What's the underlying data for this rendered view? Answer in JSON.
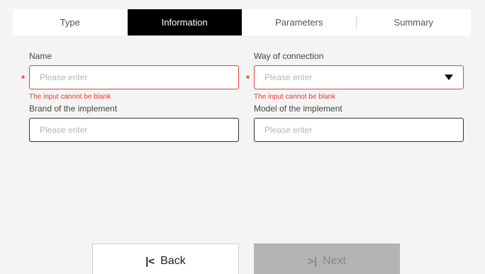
{
  "tabs": [
    {
      "label": "Type"
    },
    {
      "label": "Information"
    },
    {
      "label": "Parameters"
    },
    {
      "label": "Summary"
    }
  ],
  "form": {
    "name": {
      "label": "Name",
      "placeholder": "Please enter",
      "error": "The input cannot be blank",
      "required_mark": "*"
    },
    "connection": {
      "label": "Way of connection",
      "placeholder": "Please enter",
      "error": "The input cannot be blank",
      "required_mark": "*"
    },
    "brand": {
      "label": "Brand of the implement",
      "placeholder": "Please enter"
    },
    "model": {
      "label": "Model of the implement",
      "placeholder": "Please enter"
    }
  },
  "footer": {
    "back": {
      "label": "Back",
      "icon": "|<"
    },
    "next": {
      "label": "Next",
      "icon": ">|"
    }
  },
  "colors": {
    "active_tab_bg": "#000000",
    "error": "#e53935",
    "next_disabled_bg": "#b3b3b3"
  },
  "icons": {
    "back": "back-to-start-icon",
    "next": "skip-to-end-icon",
    "dropdown": "caret-down-icon"
  }
}
